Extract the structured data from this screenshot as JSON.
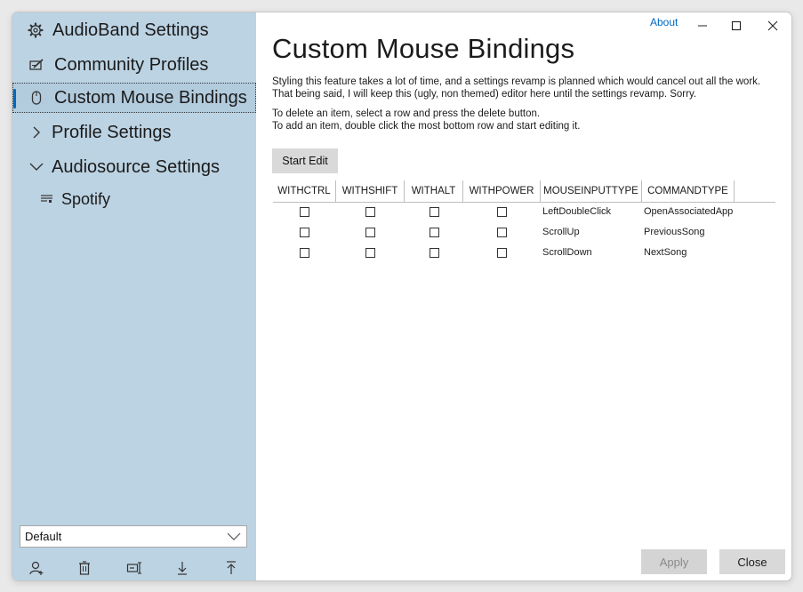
{
  "window": {
    "about_label": "About"
  },
  "sidebar": {
    "items": [
      {
        "label": "AudioBand Settings",
        "icon": "gear-icon"
      },
      {
        "label": "Community Profiles",
        "icon": "edit-icon"
      },
      {
        "label": "Custom Mouse Bindings",
        "icon": "mouse-icon",
        "selected": true
      },
      {
        "label": "Profile Settings",
        "icon": "chevron-right-icon"
      },
      {
        "label": "Audiosource Settings",
        "icon": "chevron-down-icon"
      },
      {
        "label": "Spotify",
        "icon": "audiosource-icon"
      }
    ],
    "profile_dropdown": {
      "selected": "Default"
    },
    "bottom_icons": [
      "add-user-icon",
      "delete-icon",
      "rename-icon",
      "import-icon",
      "export-icon"
    ]
  },
  "main": {
    "title": "Custom Mouse Bindings",
    "desc_line1": "Styling this feature takes a lot of time, and a settings revamp is planned which would cancel out all the work.",
    "desc_line2": "That being said, I will keep this (ugly, non themed) editor here until the settings revamp. Sorry.",
    "desc_line3": "To delete an item, select a row and press the delete button.",
    "desc_line4": "To add an item, double click the most bottom row and start editing it.",
    "start_edit_label": "Start Edit",
    "table": {
      "columns": [
        "WITHCTRL",
        "WITHSHIFT",
        "WITHALT",
        "WITHPOWER",
        "MOUSEINPUTTYPE",
        "COMMANDTYPE"
      ],
      "rows": [
        {
          "withctrl": false,
          "withshift": false,
          "withalt": false,
          "withpower": false,
          "mouseinputtype": "LeftDoubleClick",
          "commandtype": "OpenAssociatedApp"
        },
        {
          "withctrl": false,
          "withshift": false,
          "withalt": false,
          "withpower": false,
          "mouseinputtype": "ScrollUp",
          "commandtype": "PreviousSong"
        },
        {
          "withctrl": false,
          "withshift": false,
          "withalt": false,
          "withpower": false,
          "mouseinputtype": "ScrollDown",
          "commandtype": "NextSong"
        }
      ]
    },
    "apply_label": "Apply",
    "close_label": "Close"
  },
  "colors": {
    "sidebar_bg": "#bcd3e3",
    "accent": "#0067c0",
    "button_bg": "#d9d9d9"
  }
}
